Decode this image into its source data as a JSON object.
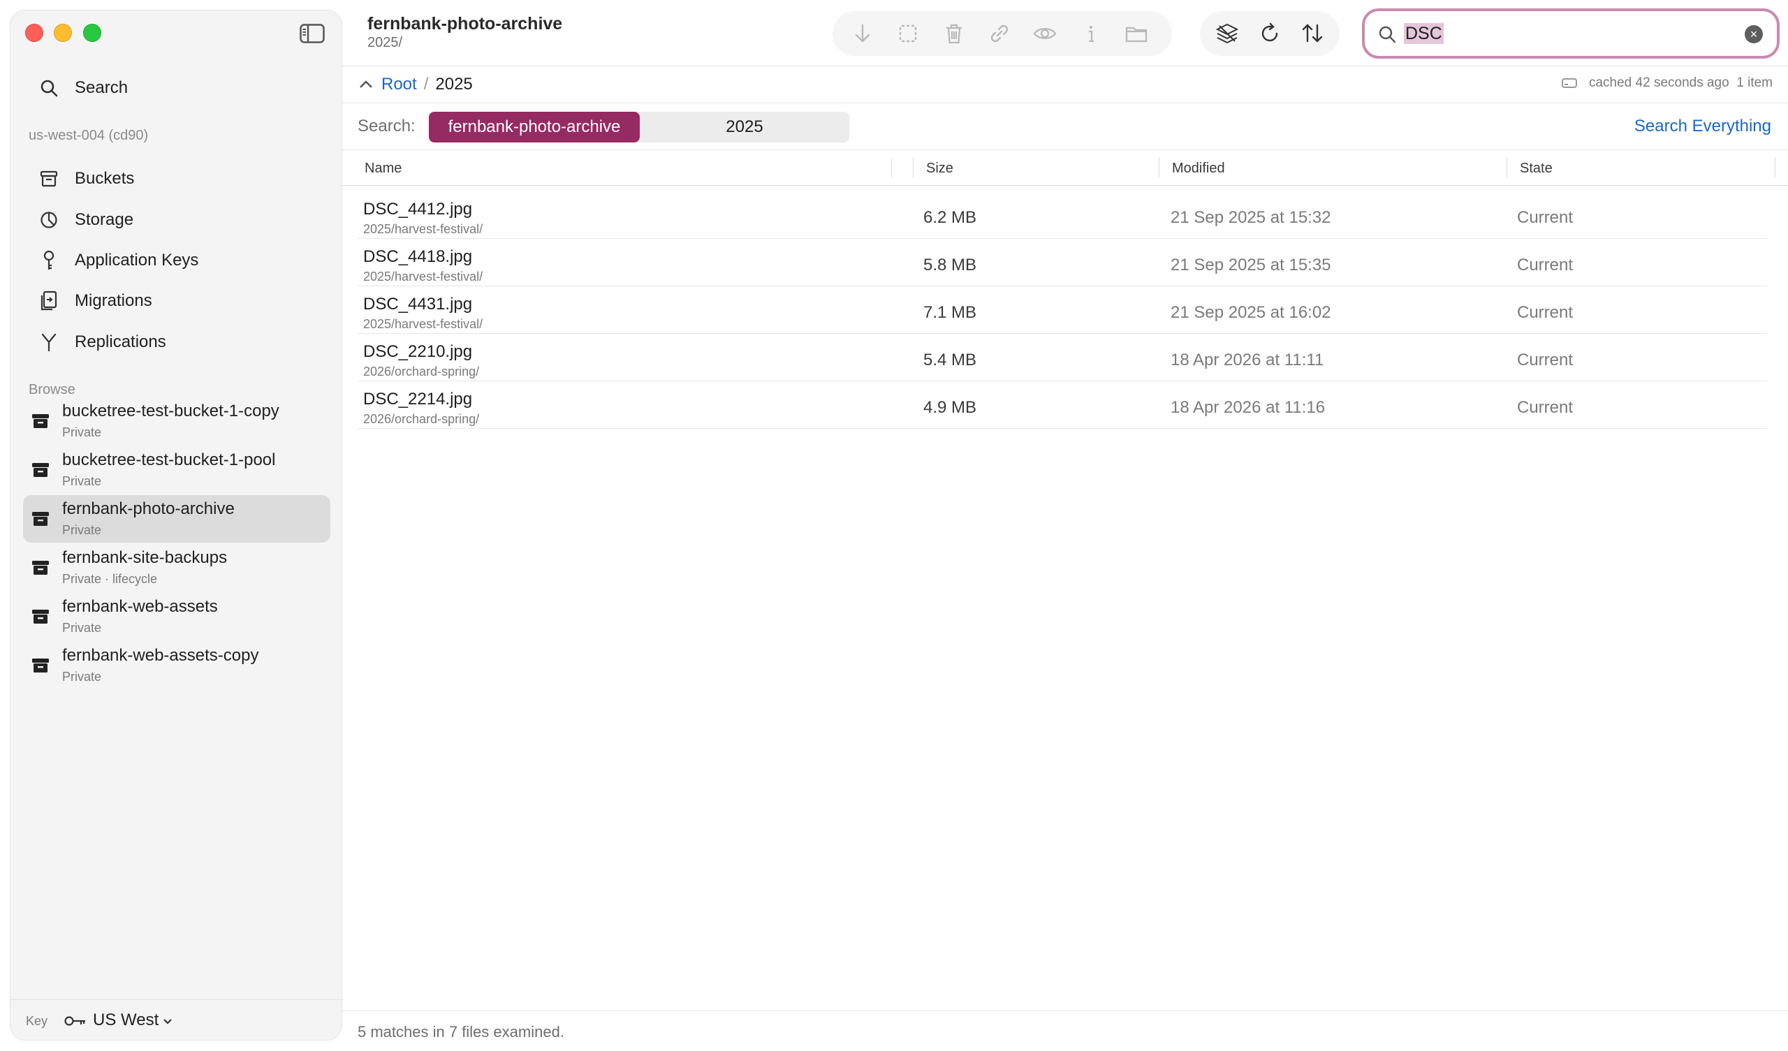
{
  "window": {
    "title": "fernbank-photo-archive",
    "subtitle": "2025/"
  },
  "sidebar": {
    "search_label": "Search",
    "region_header": "us-west-004 (cd90)",
    "nav": [
      {
        "label": "Buckets",
        "icon": "bucket-icon"
      },
      {
        "label": "Storage",
        "icon": "pie-chart-icon"
      },
      {
        "label": "Application Keys",
        "icon": "key-icon"
      },
      {
        "label": "Migrations",
        "icon": "migrations-icon"
      },
      {
        "label": "Replications",
        "icon": "replications-icon"
      }
    ],
    "browse_header": "Browse",
    "buckets": [
      {
        "name": "bucketree-test-bucket-1-copy",
        "sub": "Private"
      },
      {
        "name": "bucketree-test-bucket-1-pool",
        "sub": "Private"
      },
      {
        "name": "fernbank-photo-archive",
        "sub": "Private"
      },
      {
        "name": "fernbank-site-backups",
        "sub": "Private · lifecycle"
      },
      {
        "name": "fernbank-web-assets",
        "sub": "Private"
      },
      {
        "name": "fernbank-web-assets-copy",
        "sub": "Private"
      }
    ],
    "footer": {
      "key_label": "Key",
      "region": "US West"
    }
  },
  "toolbar": {
    "icons": [
      "download-icon",
      "select-icon",
      "trash-icon",
      "link-icon",
      "eye-icon",
      "info-icon",
      "folder-icon",
      "layers-icon",
      "refresh-icon",
      "sort-icon"
    ]
  },
  "search": {
    "value": "DSC"
  },
  "breadcrumb": {
    "root": "Root",
    "separator": "/",
    "current": "2025"
  },
  "cache_status": "cached 42 seconds ago  1 item",
  "scope": {
    "label": "Search:",
    "options": [
      "fernbank-photo-archive",
      "2025"
    ],
    "selected": "fernbank-photo-archive",
    "search_everything": "Search Everything"
  },
  "table": {
    "columns": [
      "Name",
      "Size",
      "Modified",
      "State"
    ],
    "rows": [
      {
        "name": "DSC_4412.jpg",
        "path": "2025/harvest-festival/",
        "size": "6.2 MB",
        "modified": "21 Sep 2025 at 15:32",
        "state": "Current"
      },
      {
        "name": "DSC_4418.jpg",
        "path": "2025/harvest-festival/",
        "size": "5.8 MB",
        "modified": "21 Sep 2025 at 15:35",
        "state": "Current"
      },
      {
        "name": "DSC_4431.jpg",
        "path": "2025/harvest-festival/",
        "size": "7.1 MB",
        "modified": "21 Sep 2025 at 16:02",
        "state": "Current"
      },
      {
        "name": "DSC_2210.jpg",
        "path": "2026/orchard-spring/",
        "size": "5.4 MB",
        "modified": "18 Apr 2026 at 11:11",
        "state": "Current"
      },
      {
        "name": "DSC_2214.jpg",
        "path": "2026/orchard-spring/",
        "size": "4.9 MB",
        "modified": "18 Apr 2026 at 11:16",
        "state": "Current"
      }
    ]
  },
  "status_bar": "5 matches in 7 files examined.",
  "colors": {
    "accent": "#962a62",
    "link": "#1a67c9",
    "search_ring": "#c88bb0"
  }
}
